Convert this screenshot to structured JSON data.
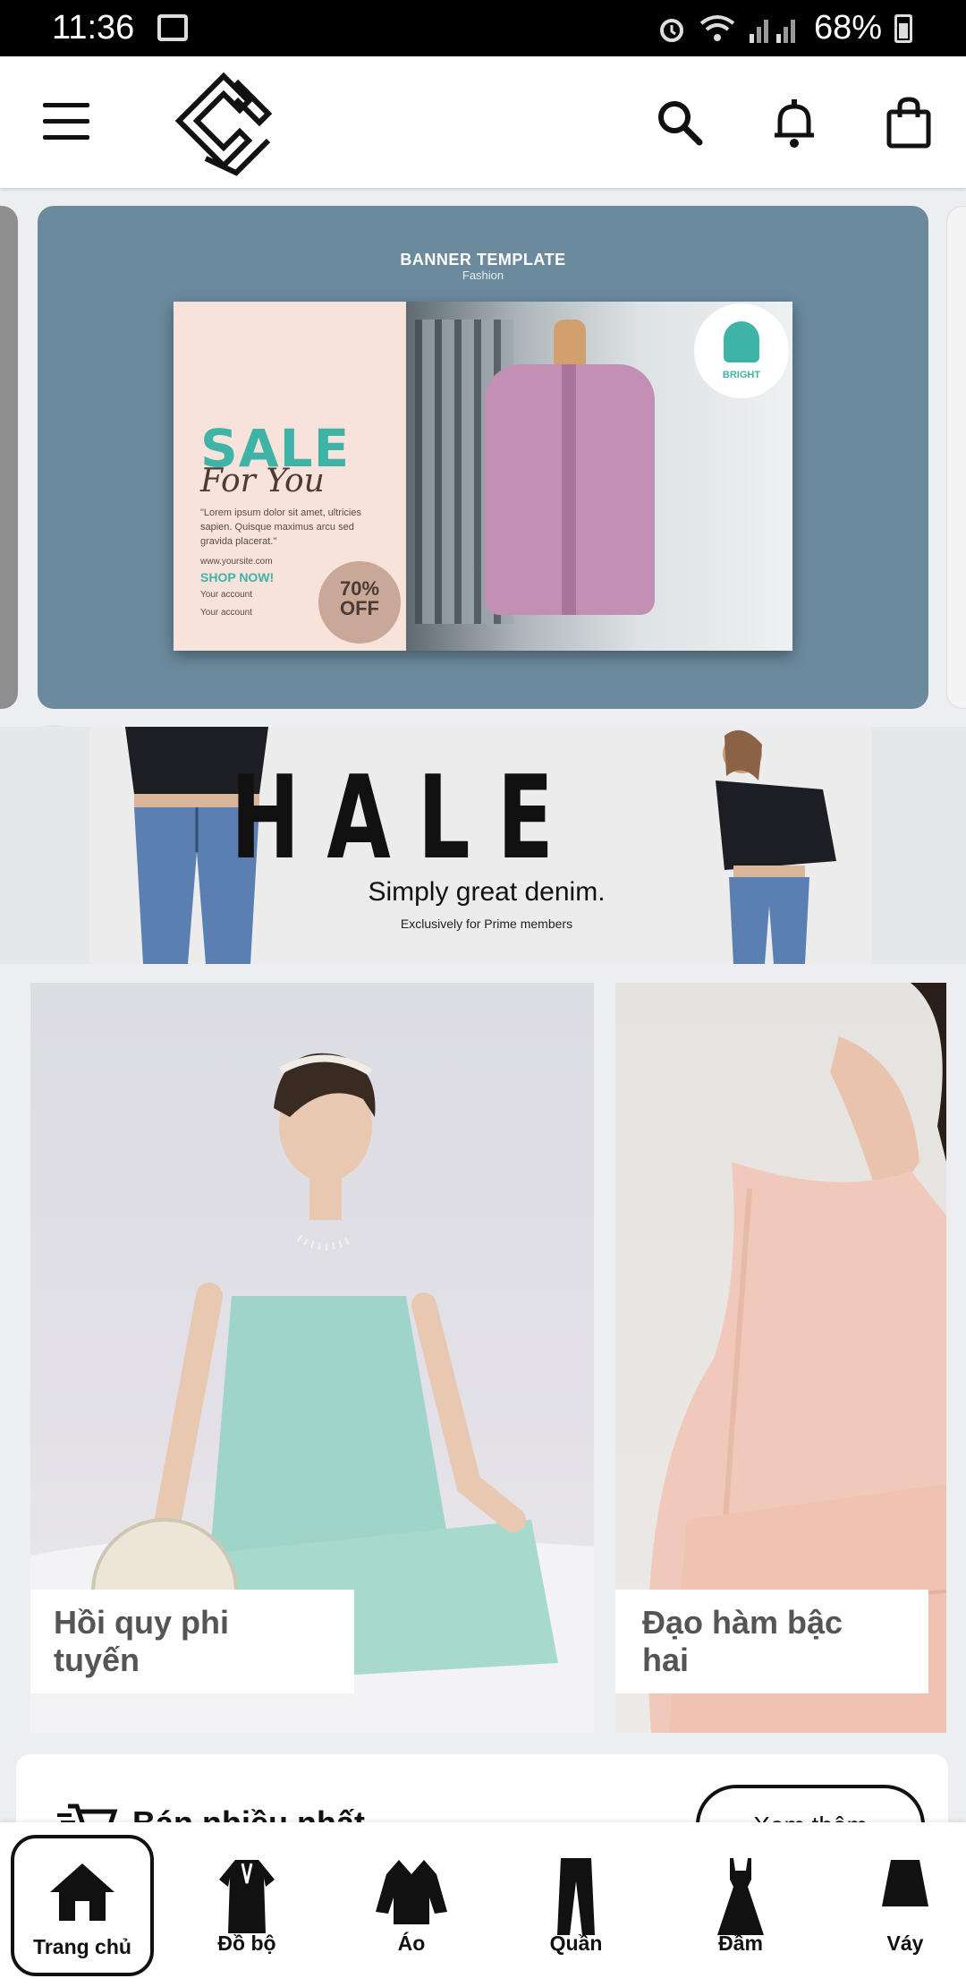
{
  "status_bar": {
    "time": "11:36",
    "battery": "68%"
  },
  "banner1": {
    "title": "BANNER TEMPLATE",
    "subtitle": "Fashion",
    "sale": "SALE",
    "for_you": "For You",
    "lorem": "\"Lorem ipsum dolor sit amet, ultricies sapien. Quisque maximus arcu sed gravida placerat.\"",
    "url": "www.yoursite.com",
    "shop_now": "SHOP NOW!",
    "account1": "Your account",
    "account2": "Your account",
    "discount": "70% OFF",
    "brand": "BRIGHT"
  },
  "banner2": {
    "word": "HALE",
    "tagline": "Simply great denim.",
    "exclusive": "Exclusively for Prime members"
  },
  "products": [
    {
      "label": "Hồi quy phi tuyến"
    },
    {
      "label": "Đạo hàm bậc hai"
    }
  ],
  "section": {
    "title": "Bán nhiều nhất",
    "more_label": "Xem thêm"
  },
  "bottom_nav": [
    {
      "label": "Trang chủ",
      "icon": "home-icon"
    },
    {
      "label": "Đồ bộ",
      "icon": "outfit-icon"
    },
    {
      "label": "Áo",
      "icon": "shirt-icon"
    },
    {
      "label": "Quần",
      "icon": "pants-icon"
    },
    {
      "label": "Đầm",
      "icon": "dress-icon"
    },
    {
      "label": "Váy",
      "icon": "skirt-icon"
    }
  ]
}
